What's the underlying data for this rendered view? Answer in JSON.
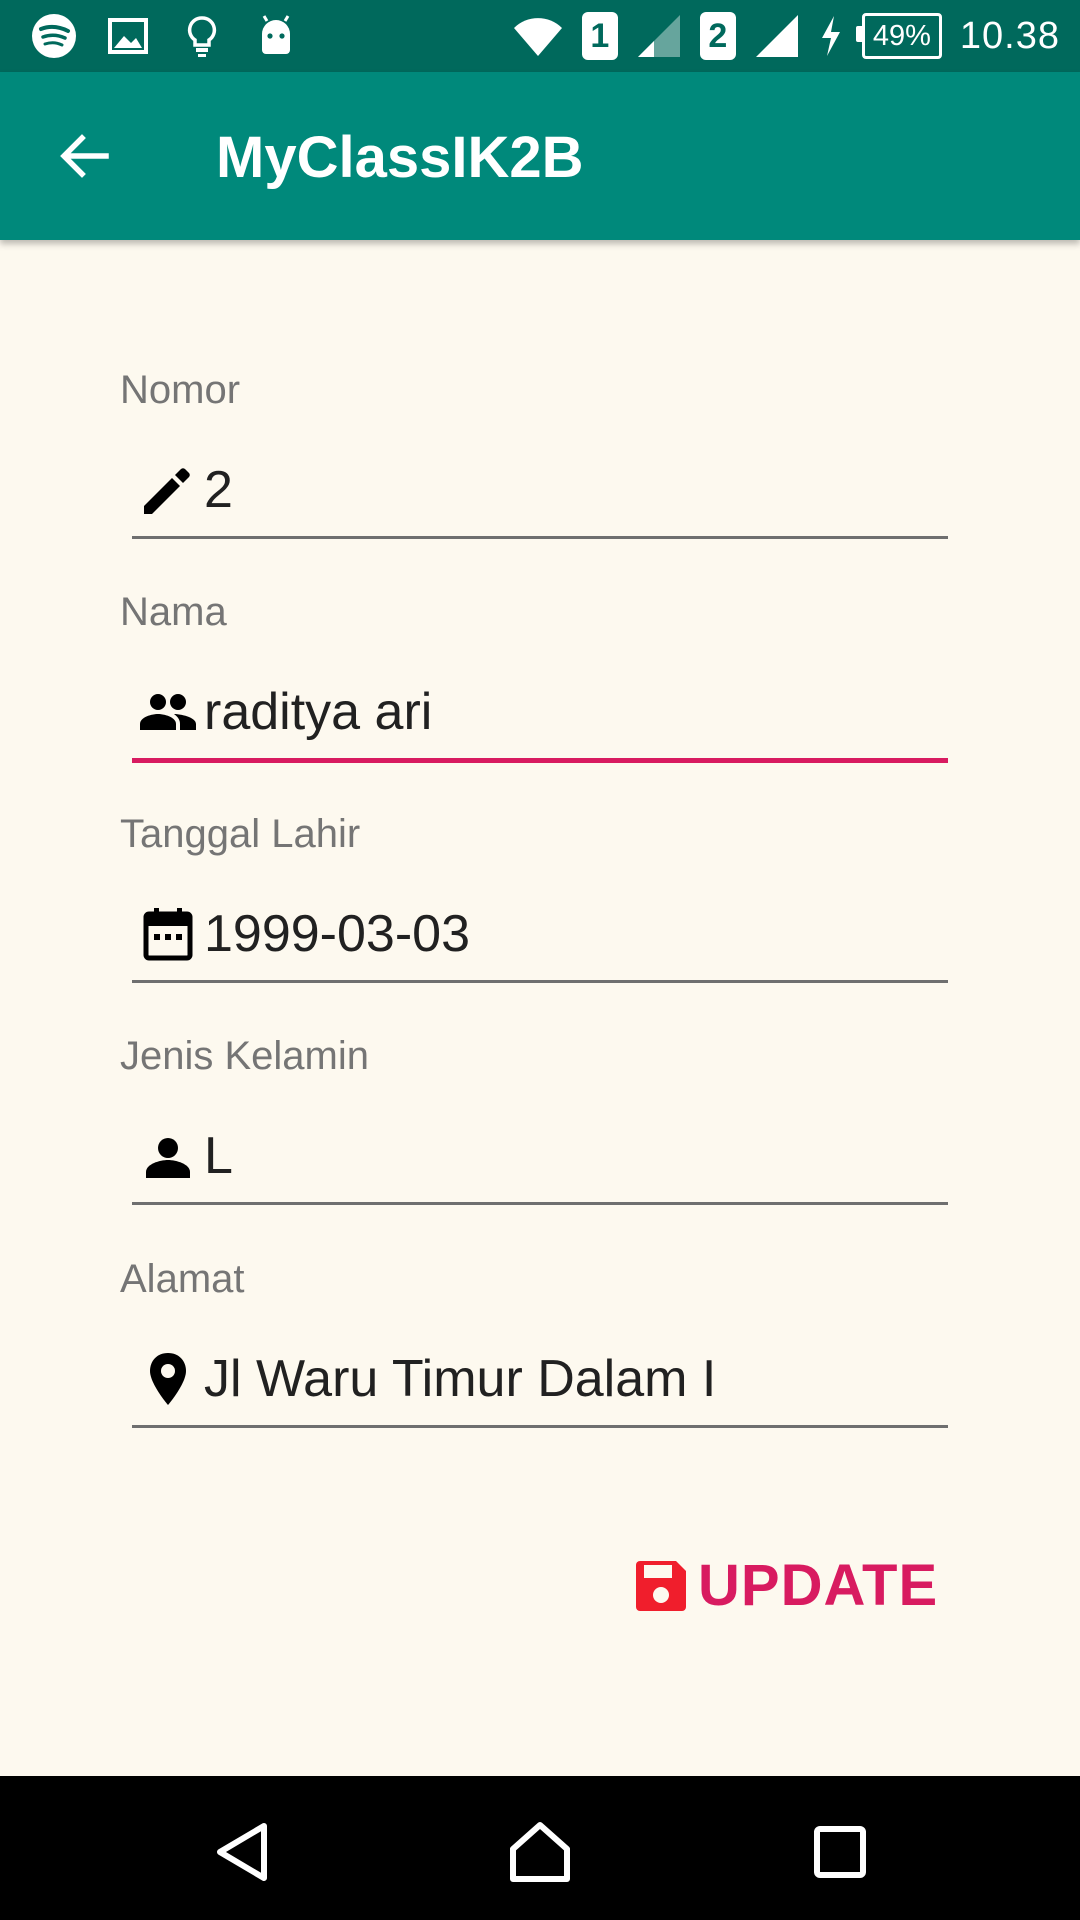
{
  "status_bar": {
    "icons_left": [
      "spotify-icon",
      "image-icon",
      "lightbulb-icon",
      "android-icon"
    ],
    "sim1": "1",
    "sim2": "2",
    "battery": "49%",
    "time": "10.38"
  },
  "app_bar": {
    "title": "MyClassIK2B",
    "back_icon": "arrow-back-icon"
  },
  "form": {
    "fields": [
      {
        "label": "Nomor",
        "value": "2",
        "icon": "pencil-icon"
      },
      {
        "label": "Nama",
        "value": "raditya ari",
        "icon": "people-icon"
      },
      {
        "label": "Tanggal Lahir",
        "value": "1999-03-03",
        "icon": "calendar-icon"
      },
      {
        "label": "Jenis Kelamin",
        "value": "L",
        "icon": "person-icon"
      },
      {
        "label": "Alamat",
        "value": "Jl Waru Timur Dalam I",
        "icon": "location-pin-icon"
      }
    ],
    "focused_field": "Nama"
  },
  "update_button": {
    "label": "UPDATE",
    "icon": "save-icon"
  },
  "colors": {
    "status_bar": "#00695C",
    "app_bar": "#00897B",
    "background": "#FDF9EF",
    "accent": "#D81B60",
    "save_icon": "#F01E2C"
  },
  "nav_bar": {
    "buttons": [
      "back-triangle-icon",
      "home-icon",
      "recents-icon"
    ]
  }
}
